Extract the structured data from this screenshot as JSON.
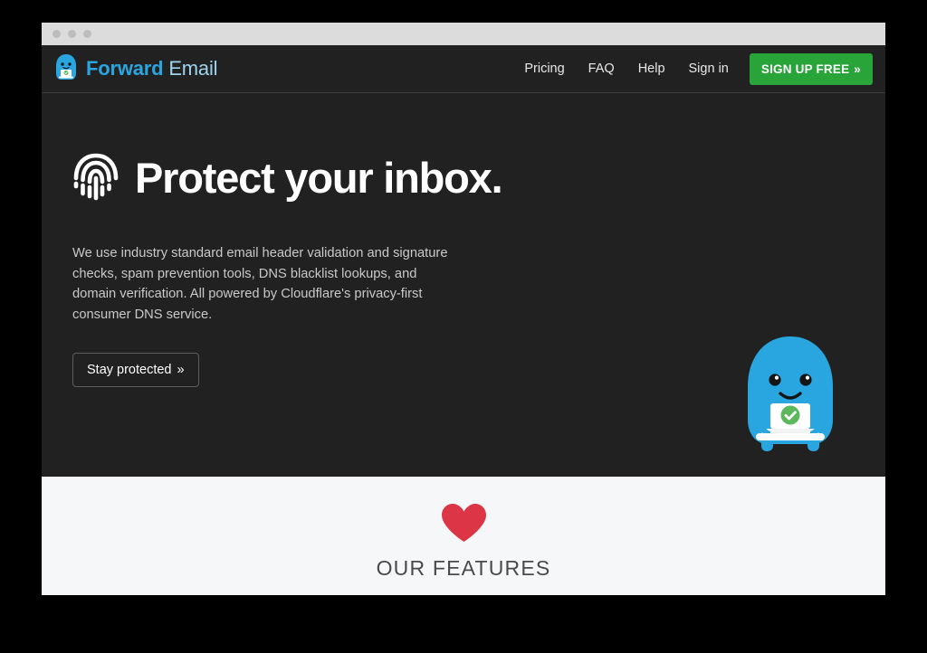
{
  "window": {
    "dots": [
      "close-dot",
      "minimize-dot",
      "maximize-dot"
    ]
  },
  "nav": {
    "brand": {
      "logo_icon": "forward-email-mascot-icon",
      "word_strong": "Forward",
      "word_light": "Email"
    },
    "links": [
      {
        "label": "Pricing",
        "name": "nav-link-pricing"
      },
      {
        "label": "FAQ",
        "name": "nav-link-faq"
      },
      {
        "label": "Help",
        "name": "nav-link-help"
      },
      {
        "label": "Sign in",
        "name": "nav-link-sign-in"
      }
    ],
    "signup": {
      "label": "SIGN UP FREE",
      "chevron": "»",
      "color": "#28a438"
    }
  },
  "hero": {
    "icon": "fingerprint-icon",
    "title": "Protect your inbox.",
    "paragraph": "We use industry standard email header validation and signature checks, spam prevention tools, DNS blacklist lookups, and domain verification. All powered by Cloudflare's privacy-first consumer DNS service.",
    "cta": {
      "label": "Stay protected",
      "chevron": "»"
    },
    "mascot_icon": "forward-email-mascot-illustration",
    "background_color": "#212121"
  },
  "features": {
    "icon": "heart-icon",
    "icon_color": "#dc3545",
    "title": "OUR FEATURES",
    "background_color": "#f5f7f9",
    "cards": [
      {
        "name": "feature-card-1"
      },
      {
        "name": "feature-card-2"
      }
    ]
  }
}
